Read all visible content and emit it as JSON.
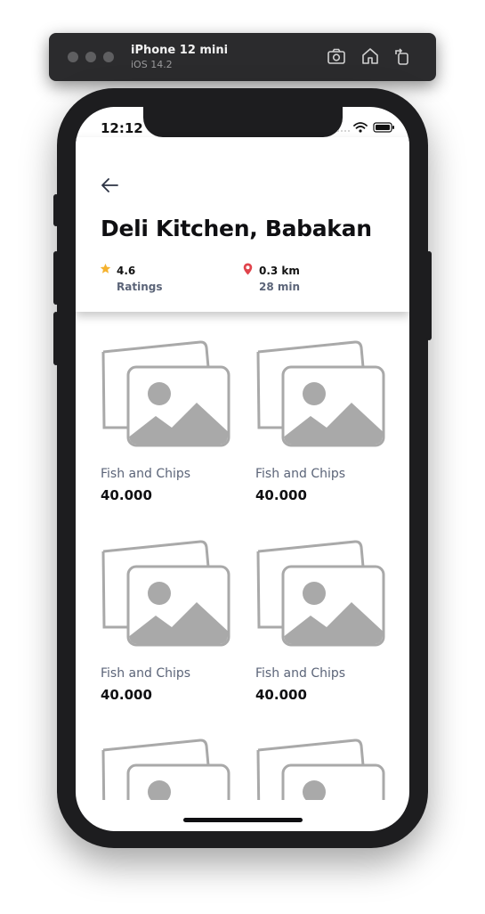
{
  "simulator": {
    "device_name": "iPhone 12 mini",
    "os_version": "iOS 14.2",
    "icons": [
      "screenshot-icon",
      "home-icon",
      "rotate-icon"
    ]
  },
  "status_bar": {
    "time": "12:12",
    "icons": [
      "wifi-icon",
      "battery-icon"
    ]
  },
  "restaurant": {
    "name": "Deli Kitchen, Babakan",
    "rating": "4.6",
    "rating_label": "Ratings",
    "distance": "0.3 km",
    "travel_time": "28 min"
  },
  "menu_items": [
    {
      "name": "Fish and Chips",
      "price": "40.000"
    },
    {
      "name": "Fish and Chips",
      "price": "40.000"
    },
    {
      "name": "Fish and Chips",
      "price": "40.000"
    },
    {
      "name": "Fish and Chips",
      "price": "40.000"
    },
    {
      "name": "",
      "price": ""
    },
    {
      "name": "",
      "price": ""
    }
  ],
  "colors": {
    "star": "#f5b22e",
    "pin": "#e0444c",
    "placeholder": "#a9a9a9",
    "subtext": "#5b6478"
  }
}
